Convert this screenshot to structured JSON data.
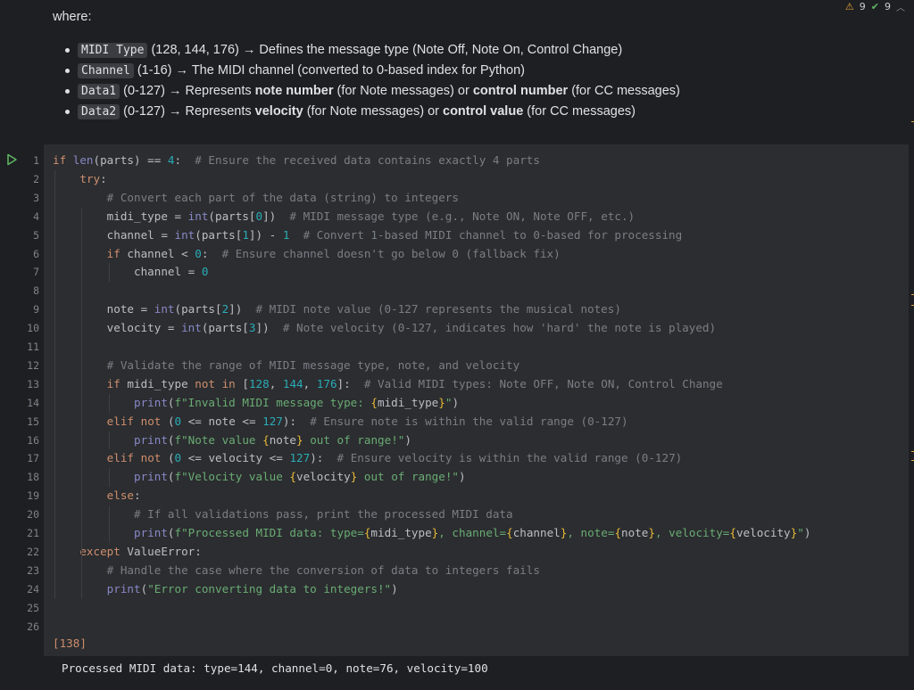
{
  "badges": {
    "warnings": "9",
    "ok": "9"
  },
  "markdown": {
    "intro": "where:",
    "items": [
      {
        "tag": "MIDI Type",
        "range": "(128, 144, 176)",
        "arrow": "→",
        "text_a": "Defines the message type (Note Off, Note On, Control Change)",
        "bold_a": "",
        "text_b": "",
        "bold_b": "",
        "text_c": ""
      },
      {
        "tag": "Channel",
        "range": "(1-16)",
        "arrow": "→",
        "text_a": "The MIDI channel (converted to 0-based index for Python)",
        "bold_a": "",
        "text_b": "",
        "bold_b": "",
        "text_c": ""
      },
      {
        "tag": "Data1",
        "range": "(0-127)",
        "arrow": "→",
        "text_a": "Represents",
        "bold_a": "note number",
        "text_b": "(for Note messages) or",
        "bold_b": "control number",
        "text_c": "(for CC messages)"
      },
      {
        "tag": "Data2",
        "range": "(0-127)",
        "arrow": "→",
        "text_a": "Represents",
        "bold_a": "velocity",
        "text_b": "(for Note messages) or",
        "bold_b": "control value",
        "text_c": "(for CC messages)"
      }
    ]
  },
  "code": {
    "line_numbers": [
      "1",
      "2",
      "3",
      "4",
      "5",
      "6",
      "7",
      "8",
      "9",
      "10",
      "11",
      "12",
      "13",
      "14",
      "15",
      "16",
      "17",
      "18",
      "19",
      "20",
      "21",
      "22",
      "23",
      "24",
      "25",
      "26"
    ],
    "lines": [
      "if len(parts) == 4:  # Ensure the received data contains exactly 4 parts",
      "    try:",
      "        # Convert each part of the data (string) to integers",
      "        midi_type = int(parts[0])  # MIDI message type (e.g., Note ON, Note OFF, etc.)",
      "        channel = int(parts[1]) - 1  # Convert 1-based MIDI channel to 0-based for processing",
      "        if channel < 0:  # Ensure channel doesn't go below 0 (fallback fix)",
      "            channel = 0",
      "",
      "        note = int(parts[2])  # MIDI note value (0-127 represents the musical notes)",
      "        velocity = int(parts[3])  # Note velocity (0-127, indicates how 'hard' the note is played)",
      "",
      "        # Validate the range of MIDI message type, note, and velocity",
      "        if midi_type not in [128, 144, 176]:  # Valid MIDI types: Note OFF, Note ON, Control Change",
      "            print(f\"Invalid MIDI message type: {midi_type}\")",
      "        elif not (0 <= note <= 127):  # Ensure note is within the valid range (0-127)",
      "            print(f\"Note value {note} out of range!\")",
      "        elif not (0 <= velocity <= 127):  # Ensure velocity is within the valid range (0-127)",
      "            print(f\"Velocity value {velocity} out of range!\")",
      "        else:",
      "            # If all validations pass, print the processed MIDI data",
      "            print(f\"Processed MIDI data: type={midi_type}, channel={channel}, note={note}, velocity={velocity}\")",
      "    except ValueError:",
      "        # Handle the case where the conversion of data to integers fails",
      "        print(\"Error converting data to integers!\")",
      "",
      ""
    ]
  },
  "execution_count": "[138]",
  "output_text": "Processed MIDI data: type=144, channel=0, note=76, velocity=100"
}
